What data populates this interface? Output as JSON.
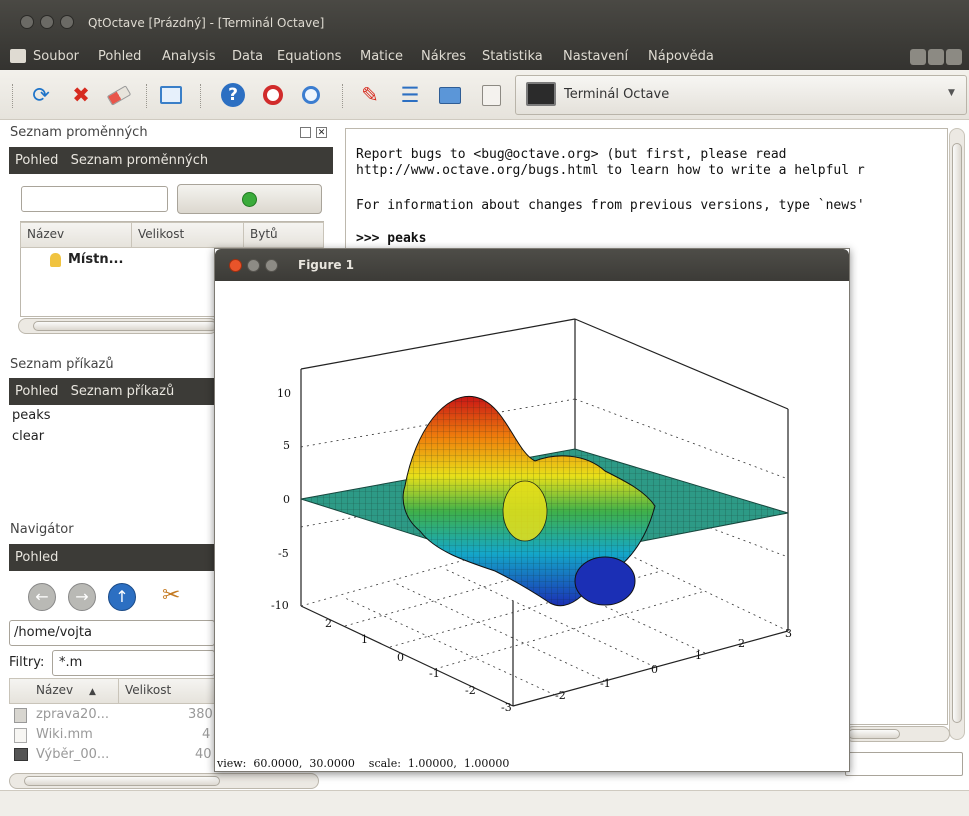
{
  "window": {
    "title": "QtOctave [Prázdný] - [Terminál Octave]"
  },
  "menu": [
    "Soubor",
    "Pohled",
    "Analysis",
    "Data",
    "Equations",
    "Matice",
    "Nákres",
    "Statistika",
    "Nastavení",
    "Nápověda"
  ],
  "toolbar": {
    "icons": [
      "refresh-icon",
      "close-icon",
      "eraser-icon",
      "window-icon",
      "help-icon",
      "search-zoom-icon",
      "find-icon",
      "pencil-icon",
      "list-icon",
      "folder-image-icon",
      "notes-icon"
    ],
    "combo_value": "Terminál Octave"
  },
  "variables_panel": {
    "title": "Seznam proměnných",
    "bar": [
      "Pohled",
      "Seznam proměnných"
    ],
    "columns": [
      "Název",
      "Velikost",
      "Bytů"
    ],
    "row": "Místn..."
  },
  "commands_panel": {
    "title": "Seznam příkazů",
    "bar": [
      "Pohled",
      "Seznam příkazů"
    ],
    "items": [
      "peaks",
      "clear"
    ]
  },
  "navigator_panel": {
    "title": "Navigátor",
    "bar": [
      "Pohled"
    ],
    "path": "/home/vojta",
    "filter_label": "Filtry:",
    "filter_value": "*.m",
    "columns": [
      "Název",
      "Velikost"
    ],
    "files": [
      {
        "name": "zprava20...",
        "size": "380"
      },
      {
        "name": "Wiki.mm",
        "size": "4"
      },
      {
        "name": "Výběr_00...",
        "size": "40"
      }
    ]
  },
  "terminal": {
    "lines": [
      "Report bugs to <bug@octave.org> (but first, please read",
      "http://www.octave.org/bugs.html to learn how to write a helpful r",
      "For information about changes from previous versions, type `news'",
      ">>> peaks"
    ]
  },
  "figure": {
    "title": "Figure 1",
    "z_ticks": [
      "10",
      "5",
      "0",
      "-5",
      "-10"
    ],
    "x_ticks": [
      "-3",
      "-2",
      "-1",
      "0",
      "1",
      "2",
      "3"
    ],
    "y_ticks": [
      "3",
      "2",
      "1",
      "0",
      "-1",
      "-2",
      "-3"
    ],
    "status": "view:  60.0000,  30.0000    scale:  1.00000,  1.00000"
  }
}
